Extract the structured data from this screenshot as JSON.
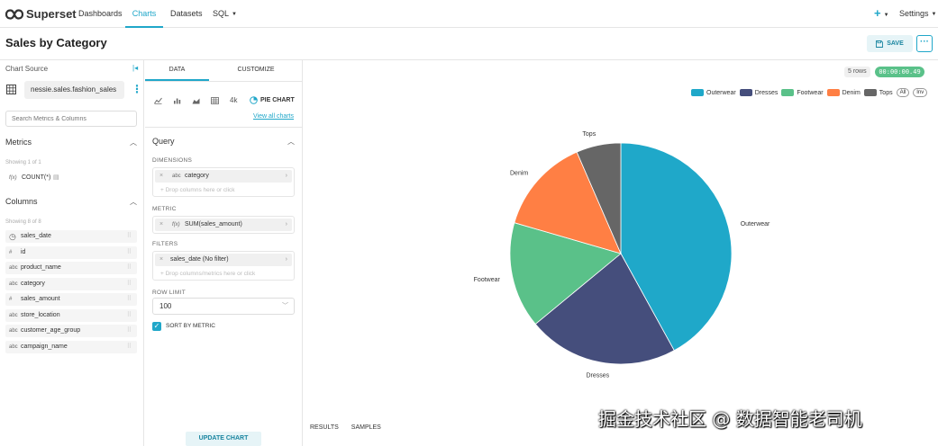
{
  "app": {
    "brand": "Superset",
    "nav": [
      "Dashboards",
      "Charts",
      "Datasets",
      "SQL"
    ],
    "settings": "Settings",
    "plus": "+"
  },
  "header": {
    "title": "Sales by Category",
    "save": "SAVE",
    "more": "···"
  },
  "datasource": {
    "section_label": "Chart Source",
    "name": "nessie.sales.fashion_sales",
    "search_placeholder": "Search Metrics & Columns",
    "metrics_title": "Metrics",
    "metrics_showing": "Showing 1 of 1",
    "metrics": [
      {
        "type": "f(x)",
        "name": "COUNT(*)"
      }
    ],
    "columns_title": "Columns",
    "columns_showing": "Showing 8 of 8",
    "columns": [
      {
        "type": "clock",
        "name": "sales_date"
      },
      {
        "type": "#",
        "name": "id"
      },
      {
        "type": "abc",
        "name": "product_name"
      },
      {
        "type": "abc",
        "name": "category"
      },
      {
        "type": "#",
        "name": "sales_amount"
      },
      {
        "type": "abc",
        "name": "store_location"
      },
      {
        "type": "abc",
        "name": "customer_age_group"
      },
      {
        "type": "abc",
        "name": "campaign_name"
      }
    ]
  },
  "controls": {
    "tabs": [
      "DATA",
      "CUSTOMIZE"
    ],
    "viz_type": "PIE CHART",
    "viz_icon_text": "4k",
    "view_all": "View all charts",
    "query_title": "Query",
    "dimensions_label": "DIMENSIONS",
    "dimension": {
      "type": "abc",
      "name": "category"
    },
    "dimensions_drop": "Drop columns here or click",
    "metric_label": "METRIC",
    "metric": {
      "type": "f(x)",
      "name": "SUM(sales_amount)"
    },
    "filters_label": "FILTERS",
    "filter": "sales_date (No filter)",
    "filters_drop": "Drop columns/metrics here or click",
    "row_limit_label": "ROW LIMIT",
    "row_limit": "100",
    "sort_by_metric": "SORT BY METRIC",
    "update_chart": "UPDATE CHART"
  },
  "results": {
    "rows": "5 rows",
    "time": "00:00:00.49",
    "tabs": [
      "RESULTS",
      "SAMPLES"
    ],
    "legend_all": "All",
    "legend_inv": "Inv"
  },
  "watermark": "掘金技术社区 @ 数据智能老司机",
  "chart_data": {
    "type": "pie",
    "categories": [
      "Outerwear",
      "Dresses",
      "Footwear",
      "Denim",
      "Tops"
    ],
    "values": [
      42,
      22,
      15.5,
      14,
      6.5
    ],
    "colors": [
      "#1fa8c9",
      "#454e7c",
      "#5ac189",
      "#ff7f44",
      "#666666"
    ],
    "legend_position": "top-right"
  }
}
